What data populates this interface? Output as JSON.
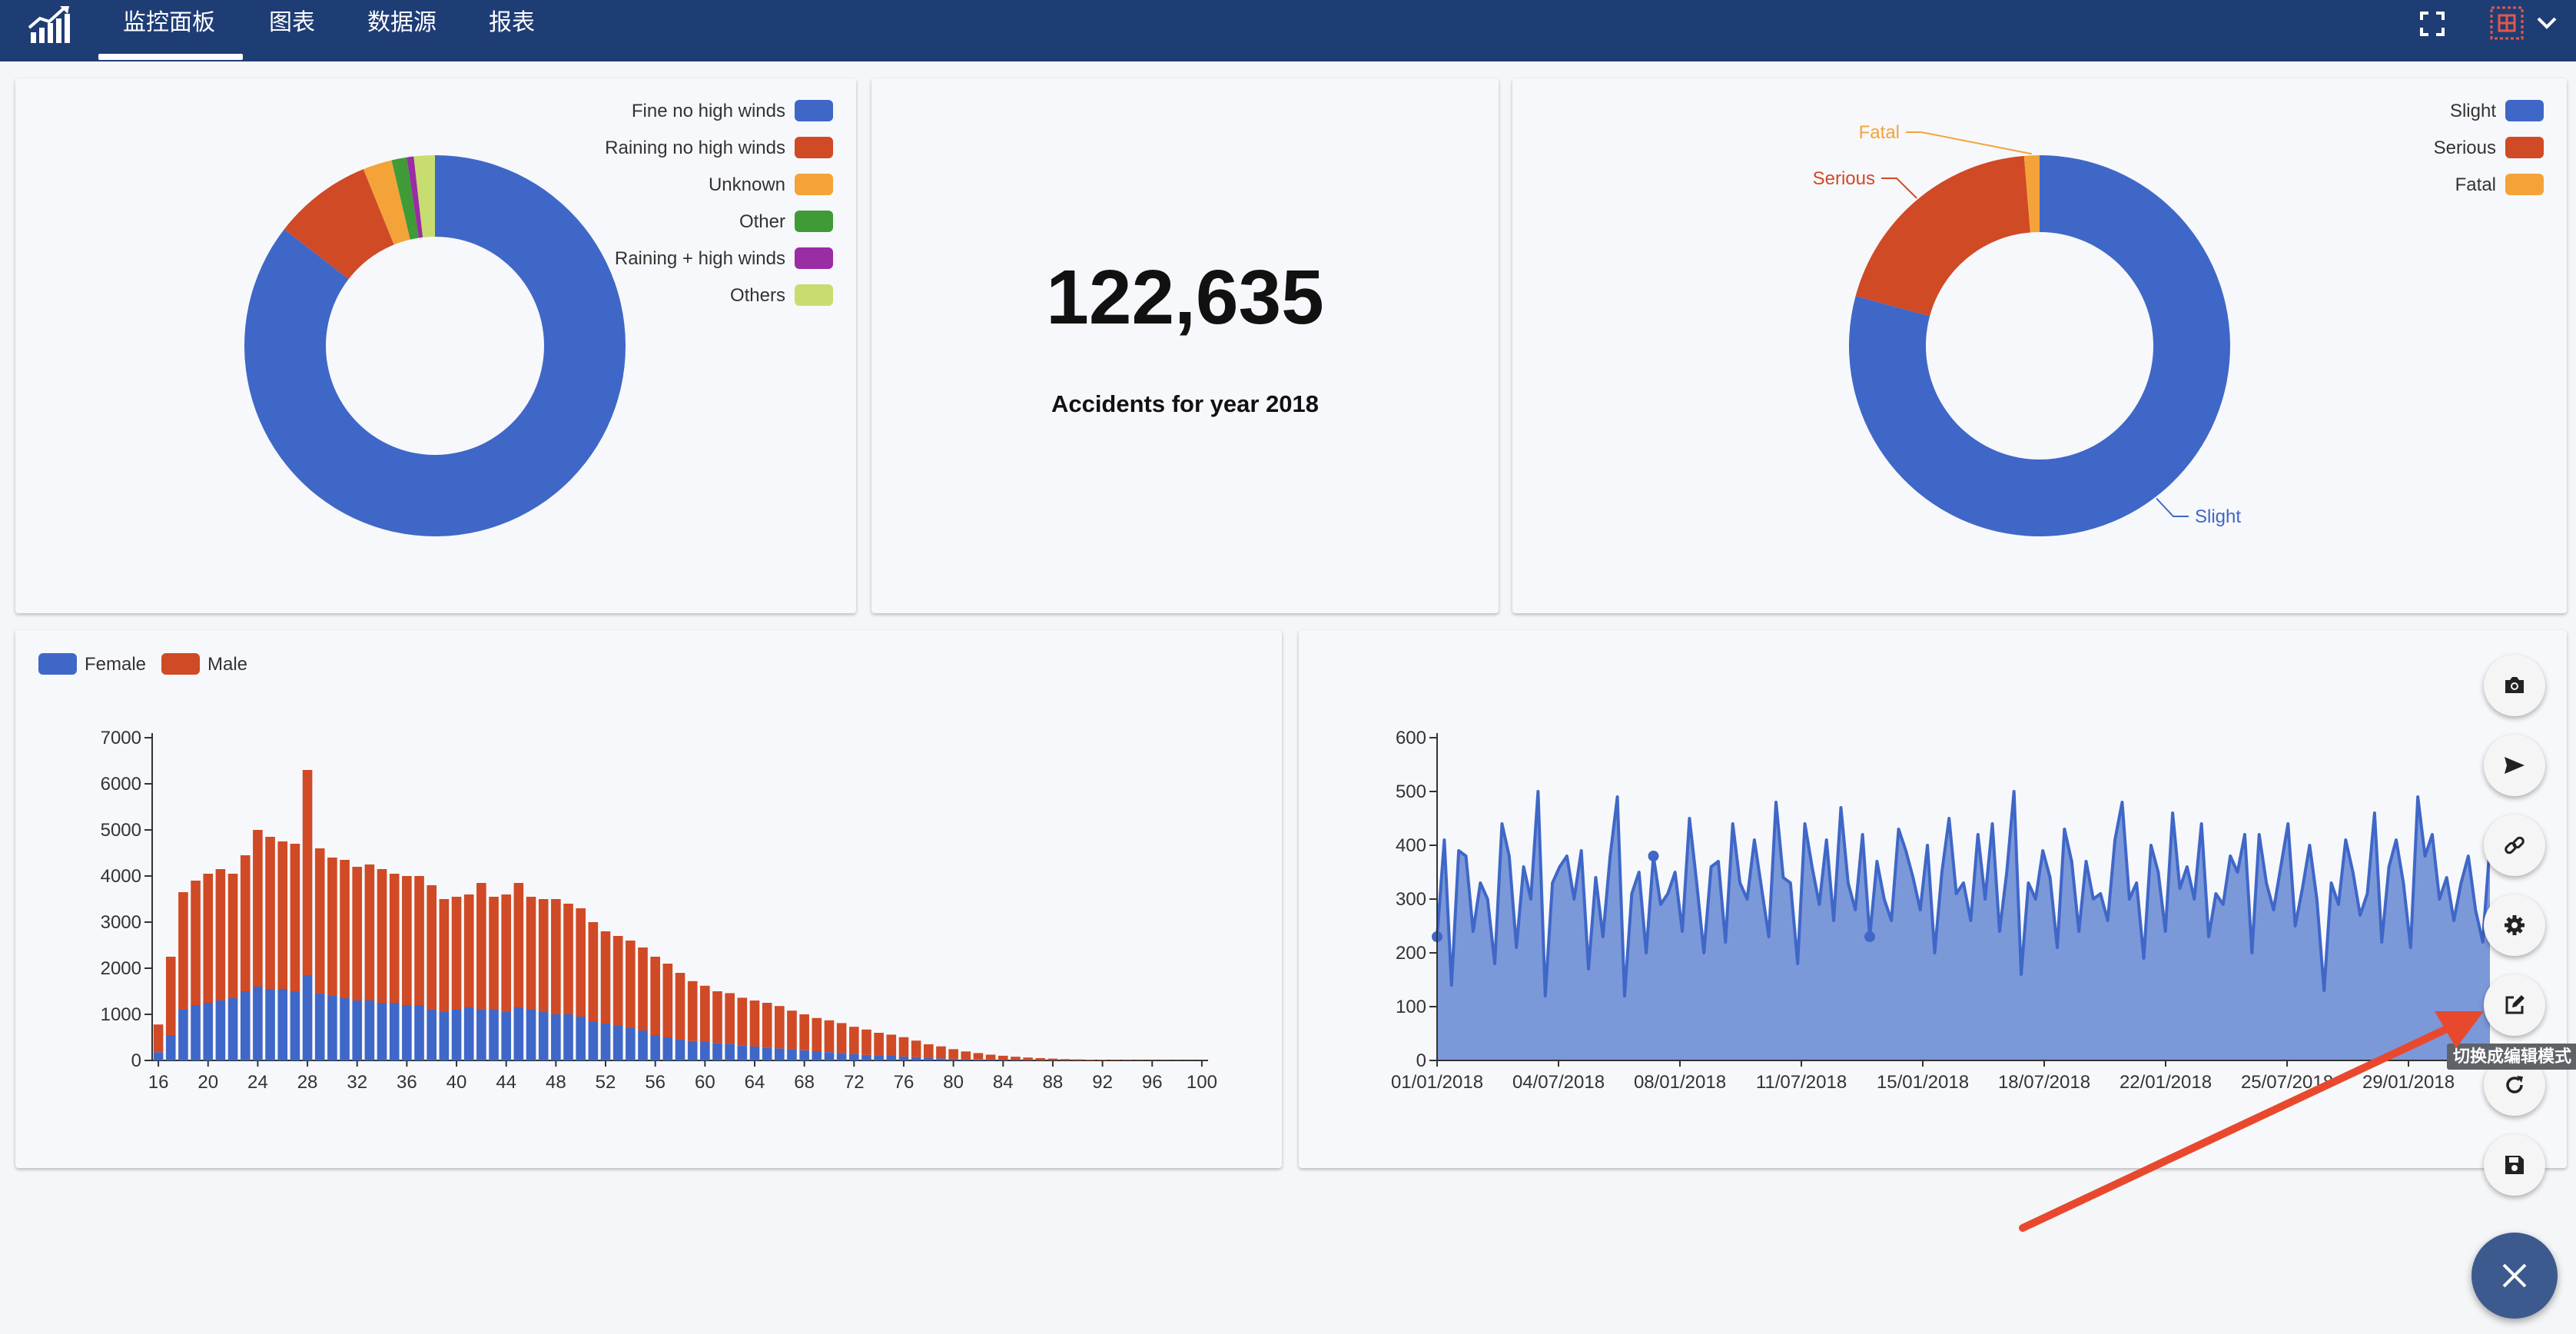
{
  "nav": {
    "tabs": [
      {
        "label": "监控面板",
        "active": true
      },
      {
        "label": "图表",
        "active": false
      },
      {
        "label": "数据源",
        "active": false
      },
      {
        "label": "报表",
        "active": false
      }
    ]
  },
  "kpi": {
    "value": "122,635",
    "label": "Accidents for year 2018"
  },
  "chart_data": [
    {
      "type": "pie",
      "donut": true,
      "legend_position": "top-right",
      "slices": [
        {
          "label": "Fine no high winds",
          "value": 86.5,
          "color": "#3f67c8"
        },
        {
          "label": "Raining no high winds",
          "value": 8.5,
          "color": "#d04a26"
        },
        {
          "label": "Unknown",
          "value": 2.5,
          "color": "#f4a339"
        },
        {
          "label": "Other",
          "value": 1.3,
          "color": "#3e9b36"
        },
        {
          "label": "Raining + high winds",
          "value": 0.6,
          "color": "#9a2ca4"
        },
        {
          "label": "Others",
          "value": 1.8,
          "color": "#c8dd6f"
        }
      ]
    },
    {
      "type": "pie",
      "donut": true,
      "legend_position": "top-right",
      "slices": [
        {
          "label": "Slight",
          "value": 79.2,
          "color": "#3f67c8"
        },
        {
          "label": "Serious",
          "value": 19.5,
          "color": "#d04a26"
        },
        {
          "label": "Fatal",
          "value": 1.3,
          "color": "#f4a339"
        }
      ]
    },
    {
      "type": "bar",
      "stacked": true,
      "legend_position": "top-left",
      "series": [
        {
          "name": "Female",
          "color": "#3f67c8",
          "values": [
            180,
            550,
            1100,
            1200,
            1250,
            1300,
            1350,
            1500,
            1600,
            1550,
            1550,
            1500,
            1850,
            1450,
            1400,
            1350,
            1300,
            1300,
            1250,
            1250,
            1200,
            1200,
            1100,
            1050,
            1100,
            1150,
            1100,
            1100,
            1050,
            1150,
            1100,
            1050,
            1000,
            1000,
            950,
            850,
            800,
            750,
            700,
            650,
            550,
            500,
            450,
            420,
            400,
            380,
            360,
            330,
            300,
            280,
            260,
            240,
            220,
            200,
            180,
            160,
            140,
            120,
            110,
            100,
            85,
            70,
            60,
            45,
            35,
            25,
            20,
            15,
            12,
            10,
            8,
            6,
            5,
            4,
            3,
            2,
            2,
            1,
            1,
            1,
            1,
            1,
            1,
            1,
            1
          ]
        },
        {
          "name": "Male",
          "color": "#d04a26",
          "values": [
            600,
            1700,
            2550,
            2700,
            2800,
            2850,
            2700,
            2950,
            3400,
            3300,
            3200,
            3200,
            4450,
            3150,
            3000,
            3000,
            2900,
            2950,
            2900,
            2800,
            2800,
            2800,
            2700,
            2450,
            2450,
            2450,
            2750,
            2450,
            2550,
            2700,
            2450,
            2450,
            2500,
            2400,
            2350,
            2150,
            2000,
            1950,
            1900,
            1800,
            1700,
            1600,
            1450,
            1300,
            1220,
            1120,
            1100,
            1030,
            1000,
            970,
            920,
            840,
            780,
            720,
            690,
            650,
            590,
            550,
            490,
            460,
            420,
            360,
            290,
            260,
            210,
            170,
            140,
            110,
            90,
            70,
            55,
            45,
            35,
            25,
            20,
            15,
            12,
            10,
            8,
            6,
            5,
            4,
            3,
            3,
            2
          ]
        }
      ],
      "x_ticks": [
        "16",
        "20",
        "24",
        "28",
        "32",
        "36",
        "40",
        "44",
        "48",
        "52",
        "56",
        "60",
        "64",
        "68",
        "72",
        "76",
        "80",
        "84",
        "88",
        "92",
        "96",
        "100"
      ],
      "x_range": [
        16,
        100
      ],
      "ylim": [
        0,
        7000
      ],
      "y_ticks": [
        0,
        1000,
        2000,
        3000,
        4000,
        5000,
        6000,
        7000
      ]
    },
    {
      "type": "area",
      "color": "#3f67c8",
      "series": [
        {
          "values": [
            230,
            410,
            140,
            390,
            380,
            240,
            330,
            300,
            180,
            440,
            380,
            210,
            360,
            300,
            500,
            120,
            330,
            360,
            380,
            300,
            390,
            170,
            340,
            230,
            380,
            490,
            120,
            310,
            350,
            200,
            380,
            290,
            310,
            350,
            240,
            450,
            330,
            200,
            360,
            370,
            220,
            440,
            330,
            300,
            410,
            320,
            230,
            480,
            340,
            330,
            180,
            440,
            360,
            290,
            410,
            260,
            470,
            330,
            280,
            420,
            230,
            370,
            300,
            260,
            430,
            390,
            340,
            280,
            400,
            200,
            350,
            450,
            310,
            330,
            260,
            420,
            300,
            440,
            240,
            350,
            500,
            160,
            330,
            300,
            390,
            340,
            210,
            430,
            370,
            240,
            370,
            300,
            310,
            260,
            410,
            480,
            300,
            330,
            190,
            400,
            350,
            240,
            460,
            320,
            360,
            300,
            440,
            230,
            310,
            290,
            380,
            350,
            420,
            200,
            420,
            330,
            280,
            360,
            440,
            250,
            320,
            400,
            300,
            130,
            330,
            290,
            410,
            350,
            270,
            310,
            460,
            220,
            360,
            410,
            330,
            210,
            490,
            380,
            420,
            300,
            340,
            260,
            330,
            380,
            280,
            220,
            400
          ]
        }
      ],
      "x_ticks": [
        "01/01/2018",
        "04/07/2018",
        "08/01/2018",
        "11/07/2018",
        "15/01/2018",
        "18/07/2018",
        "22/01/2018",
        "25/07/2018",
        "29/01/2018"
      ],
      "ylim": [
        0,
        600
      ],
      "y_ticks": [
        0,
        100,
        200,
        300,
        400,
        500,
        600
      ]
    }
  ],
  "donut2_callouts": {
    "slight": "Slight",
    "serious": "Serious",
    "fatal": "Fatal"
  },
  "fab_tooltip": "切换成编辑模式",
  "fab_actions": [
    "camera-icon",
    "send-icon",
    "link-icon",
    "gear-icon",
    "edit-icon",
    "refresh-icon",
    "save-icon"
  ]
}
